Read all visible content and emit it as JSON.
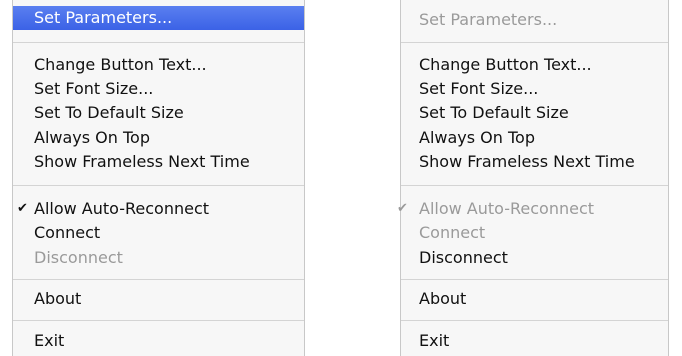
{
  "left_menu": {
    "items": [
      {
        "label": "Set Parameters...",
        "state": "highlighted"
      },
      {
        "label": "Change Button Text..."
      },
      {
        "label": "Set Font Size..."
      },
      {
        "label": "Set To Default Size"
      },
      {
        "label": "Always On Top"
      },
      {
        "label": "Show Frameless Next Time"
      },
      {
        "label": "Allow Auto-Reconnect",
        "checked": true
      },
      {
        "label": "Connect"
      },
      {
        "label": "Disconnect",
        "state": "disabled"
      },
      {
        "label": "About"
      },
      {
        "label": "Exit"
      }
    ]
  },
  "right_menu": {
    "items": [
      {
        "label": "Set Parameters...",
        "state": "disabled"
      },
      {
        "label": "Change Button Text..."
      },
      {
        "label": "Set Font Size..."
      },
      {
        "label": "Set To Default Size"
      },
      {
        "label": "Always On Top"
      },
      {
        "label": "Show Frameless Next Time"
      },
      {
        "label": "Allow Auto-Reconnect",
        "state": "disabled",
        "checked": true
      },
      {
        "label": "Connect",
        "state": "disabled"
      },
      {
        "label": "Disconnect"
      },
      {
        "label": "About"
      },
      {
        "label": "Exit"
      }
    ]
  },
  "check_mark": "✔",
  "colors": {
    "highlight": "#3b62e6",
    "disabled_text": "#9a9a9a",
    "menu_background": "#f7f7f7"
  }
}
